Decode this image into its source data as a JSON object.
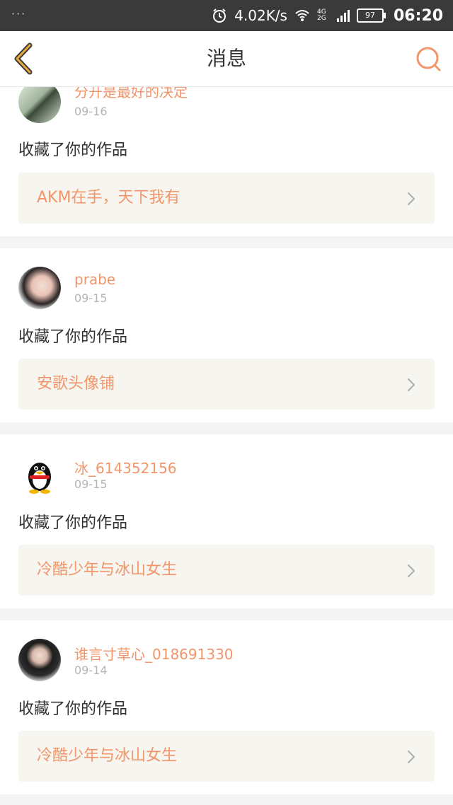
{
  "status_bar": {
    "dots": "···",
    "speed": "4.02K/s",
    "network": "4G 2G",
    "battery": "97",
    "time": "06:20"
  },
  "navbar": {
    "title": "消息",
    "back_icon": "chevron-left-icon",
    "search_icon": "search-icon"
  },
  "colors": {
    "accent": "#f2956a",
    "nav_back": "#e8a93a",
    "card_bg": "#ffffff",
    "page_bg": "#f4f4f4",
    "work_bg": "#f6f5ef"
  },
  "messages": [
    {
      "user": "分开是最好的决定",
      "date": "09-16",
      "action": "收藏了你的作品",
      "work": "AKM在手，天下我有"
    },
    {
      "user": "prabe",
      "date": "09-15",
      "action": "收藏了你的作品",
      "work": "安歌头像铺"
    },
    {
      "user": "冰_614352156",
      "date": "09-15",
      "action": "收藏了你的作品",
      "work": "冷酷少年与冰山女生"
    },
    {
      "user": "谁言寸草心_018691330",
      "date": "09-14",
      "action": "收藏了你的作品",
      "work": "冷酷少年与冰山女生"
    }
  ]
}
